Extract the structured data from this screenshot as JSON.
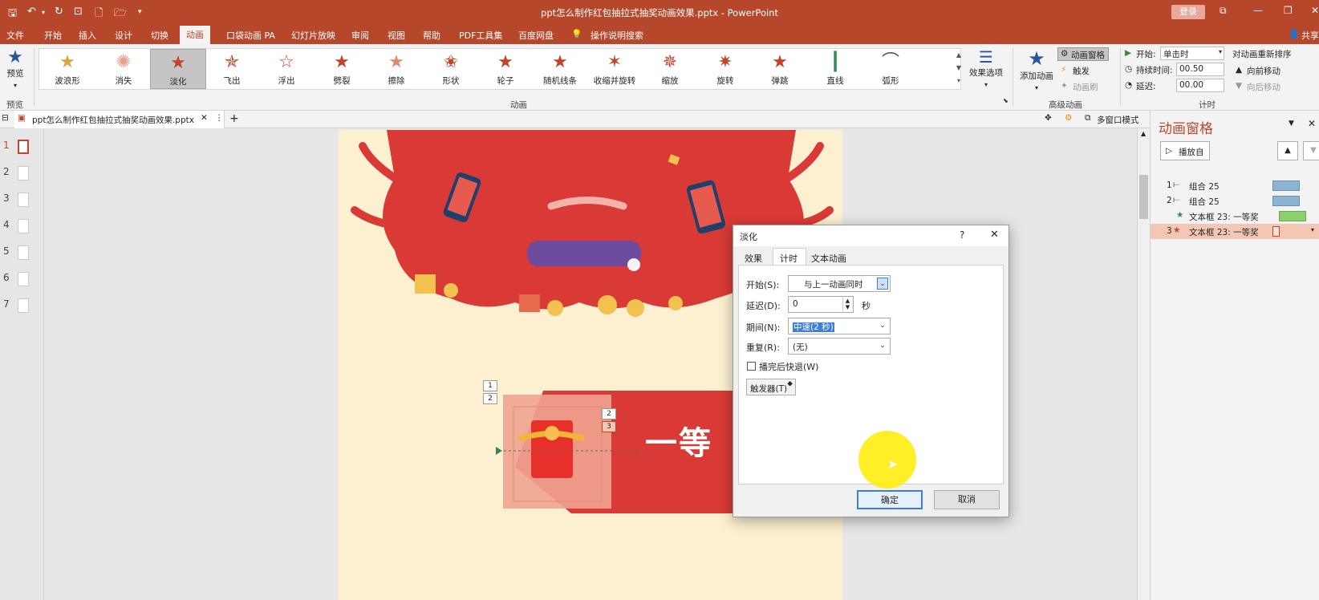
{
  "window": {
    "title": "ppt怎么制作红包抽拉式抽奖动画效果.pptx - PowerPoint",
    "login_label": "登录",
    "share_label": "共享"
  },
  "menu": {
    "items": [
      "文件",
      "开始",
      "插入",
      "设计",
      "切换",
      "动画",
      "口袋动画 PA",
      "幻灯片放映",
      "审阅",
      "视图",
      "帮助",
      "PDF工具集",
      "百度网盘"
    ],
    "active_index": 5,
    "search_label": "操作说明搜索"
  },
  "ribbon": {
    "preview_label": "预览",
    "preview_group": "预览",
    "animations": [
      "波浪形",
      "消失",
      "淡化",
      "飞出",
      "浮出",
      "劈裂",
      "擦除",
      "形状",
      "轮子",
      "随机线条",
      "收缩并旋转",
      "缩放",
      "旋转",
      "弹跳",
      "直线",
      "弧形"
    ],
    "selected_animation_index": 2,
    "effect_options_label": "效果选项",
    "animation_group": "动画",
    "add_animation_label": "添加动画",
    "anim_pane_label": "动画窗格",
    "trigger_label": "触发",
    "anim_painter_label": "动画刷",
    "advanced_group": "高级动画",
    "start_label": "开始:",
    "start_value": "单击时",
    "duration_label": "持续时间:",
    "duration_value": "00.50",
    "delay_label": "延迟:",
    "delay_value": "00.00",
    "timing_group": "计时",
    "reorder_label": "对动画重新排序",
    "move_earlier": "向前移动",
    "move_later": "向后移动"
  },
  "doc_tab": {
    "name": "ppt怎么制作红包抽拉式抽奖动画效果.pptx",
    "multiwindow_label": "多窗口模式"
  },
  "thumbnails": [
    "1",
    "2",
    "3",
    "4",
    "5",
    "6",
    "7"
  ],
  "slide": {
    "tag_1": "1",
    "tag_2": "2",
    "tag_3": "2",
    "tag_4": "3",
    "banner_text": "一等"
  },
  "anim_pane": {
    "title": "动画窗格",
    "play_label": "播放自",
    "rows": [
      {
        "num": "1",
        "name": "组合 25",
        "color": "#8db3d3"
      },
      {
        "num": "2",
        "name": "组合 25",
        "color": "#8db3d3"
      },
      {
        "num": "",
        "name": "文本框 23: 一等奖",
        "color": "#8ccf6e"
      },
      {
        "num": "3",
        "name": "文本框 23: 一等奖",
        "color": "#f4c7b4"
      }
    ]
  },
  "dialog": {
    "title": "淡化",
    "help": "?",
    "close": "✕",
    "tabs": [
      "效果",
      "计时",
      "文本动画"
    ],
    "active_tab": 1,
    "start_label": "开始(S):",
    "start_value": "与上一动画同时",
    "delay_label": "延迟(D):",
    "delay_value": "0",
    "delay_unit": "秒",
    "period_label": "期间(N):",
    "period_value": "中速(2 秒)",
    "repeat_label": "重复(R):",
    "repeat_value": "(无)",
    "rewind_label": "播完后快退(W)",
    "trigger_label": "触发器(T)",
    "ok_label": "确定",
    "cancel_label": "取消"
  }
}
